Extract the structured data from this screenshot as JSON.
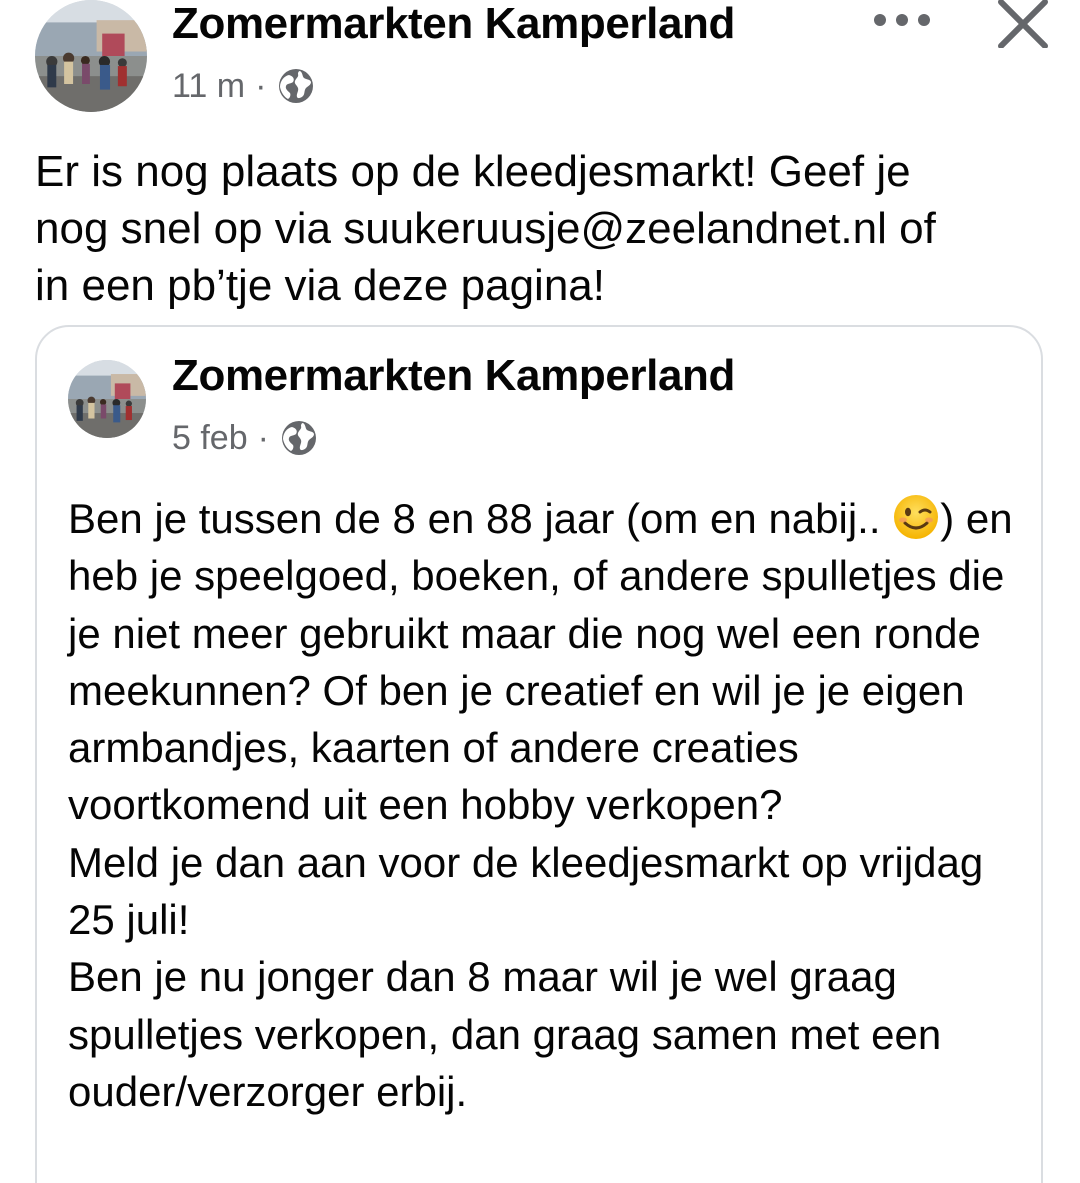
{
  "post": {
    "page_name": "Zomermarkten Kamperland",
    "time": "11 m",
    "separator": "·",
    "audience_icon": "globe-icon",
    "more_icon": "more-horizontal-icon",
    "close_icon": "close-icon",
    "text": "Er is nog plaats op de kleedjesmarkt! Geef je\nnog snel op via suukeruusje@zeelandnet.nl of\nin een pb’tje via deze pagina!"
  },
  "shared_post": {
    "page_name": "Zomermarkten Kamperland",
    "time": "5 feb",
    "separator": "·",
    "audience_icon": "globe-icon",
    "text_line1": "Ben je tussen de 8 en 88 jaar (om en nabij..",
    "emoji": "winking-face-emoji",
    "text_after_emoji": ") en heb je speelgoed, boeken, of andere spulletjes die je niet meer gebruikt maar die nog wel een ronde meekunnen? Of ben je creatief en wil je je eigen armbandjes, kaarten of andere creaties voortkomend uit een hobby verkopen?",
    "text_para2": "Meld je dan aan voor de kleedjesmarkt op vrijdag 25 juli!",
    "text_para3": "Ben je nu jonger dan 8 maar wil je wel graag spulletjes verkopen, dan graag samen met een ouder/verzorger erbij."
  },
  "colors": {
    "text_primary": "#050505",
    "text_secondary": "#65676b",
    "card_border": "#dadde1",
    "icon_grey": "#65676b"
  }
}
